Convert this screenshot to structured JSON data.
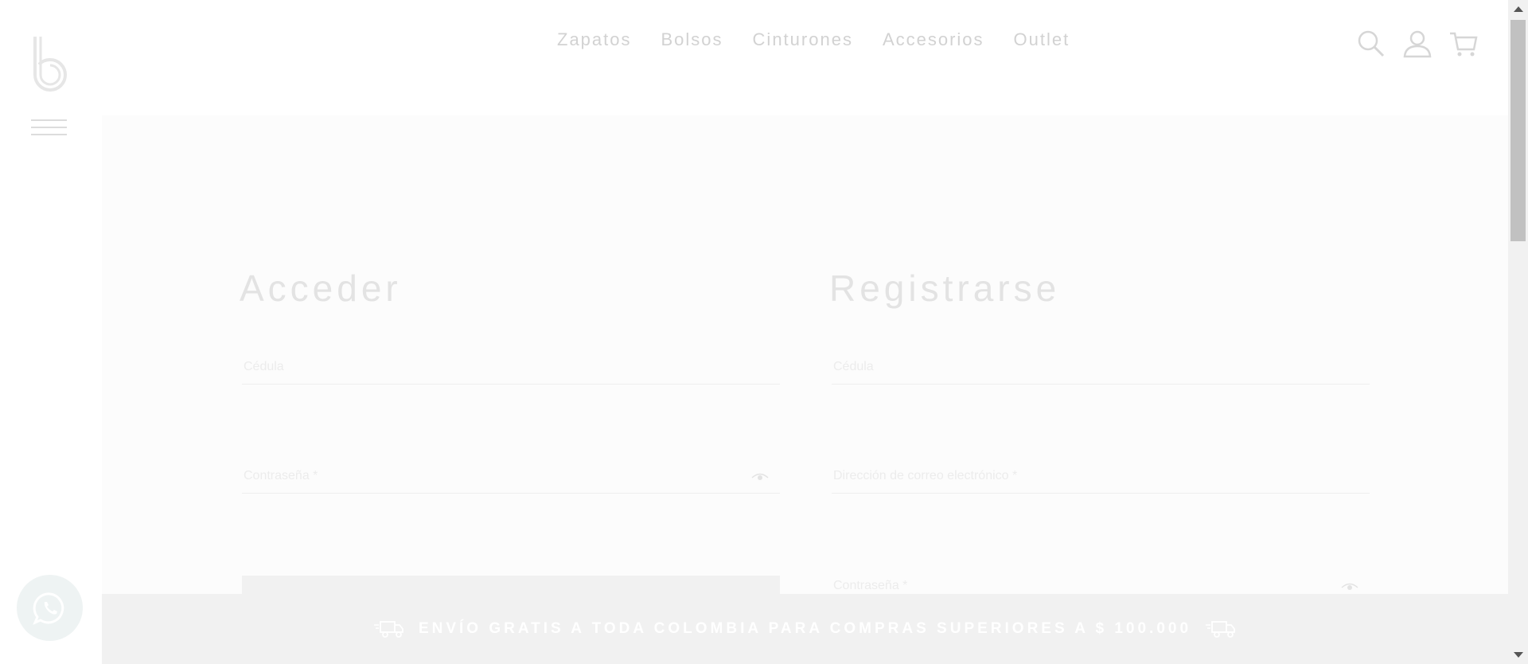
{
  "nav": {
    "items": [
      "Zapatos",
      "Bolsos",
      "Cinturones",
      "Accesorios",
      "Outlet"
    ]
  },
  "icons": {
    "search": "search-icon",
    "account": "user-icon",
    "cart": "cart-icon",
    "menu": "hamburger-icon",
    "whatsapp": "whatsapp-icon"
  },
  "login": {
    "title": "Acceder",
    "cedula_placeholder": "Cédula",
    "password_placeholder": "Contraseña *"
  },
  "register": {
    "title": "Registrarse",
    "cedula_placeholder": "Cédula",
    "email_placeholder": "Dirección de correo electrónico *",
    "password_placeholder": "Contraseña *"
  },
  "banner": {
    "text": "ENVÍO GRATIS A TODA COLOMBIA PARA COMPRAS SUPERIORES A $ 100.000"
  },
  "colors": {
    "panel_bg": "#fcfcfc",
    "banner_bg": "#f1f1f1"
  }
}
